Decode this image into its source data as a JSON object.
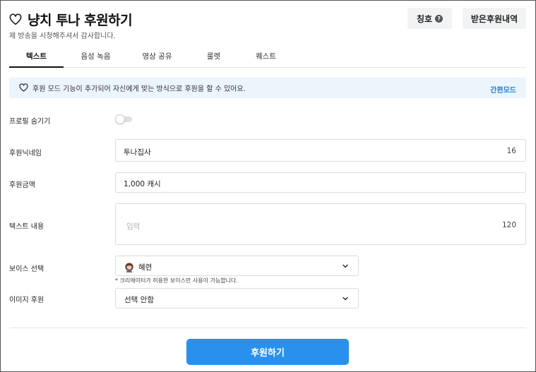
{
  "header": {
    "title": "냥치 투나 후원하기",
    "subtitle": "제 방송을 시청해주셔서 감사합니다.",
    "title_button": "칭호",
    "title_help": "?",
    "history_button": "받은후원내역"
  },
  "tabs": [
    {
      "label": "텍스트",
      "active": true
    },
    {
      "label": "음성 녹음",
      "active": false
    },
    {
      "label": "영상 공유",
      "active": false
    },
    {
      "label": "룰렛",
      "active": false
    },
    {
      "label": "퀘스트",
      "active": false
    }
  ],
  "notice": {
    "text": "후원 모드 기능이 추가되어 자신에게 맞는 방식으로 후원을 할 수 있어요.",
    "link": "간편모드"
  },
  "form": {
    "hide_profile": {
      "label": "프로필 숨기기",
      "enabled": false
    },
    "nickname": {
      "label": "후원닉네임",
      "value": "투나집사",
      "count": "16"
    },
    "amount": {
      "label": "후원금액",
      "value": "1,000 캐시"
    },
    "message": {
      "label": "텍스트 내용",
      "placeholder": "입력",
      "count": "120"
    },
    "voice": {
      "label": "보이스 선택",
      "selected": "혜련",
      "hint": "* 크리에이터가 허용한 보이스만 사용이 가능합니다."
    },
    "image": {
      "label": "이미지 후원",
      "selected": "선택 안함"
    }
  },
  "submit_label": "후원하기",
  "colors": {
    "accent": "#2a90ee",
    "notice_bg": "#ecf4fc",
    "link": "#1e7fe0"
  },
  "icons": [
    "heart-icon",
    "help-icon",
    "chevron-down-icon",
    "voice-avatar-icon"
  ]
}
